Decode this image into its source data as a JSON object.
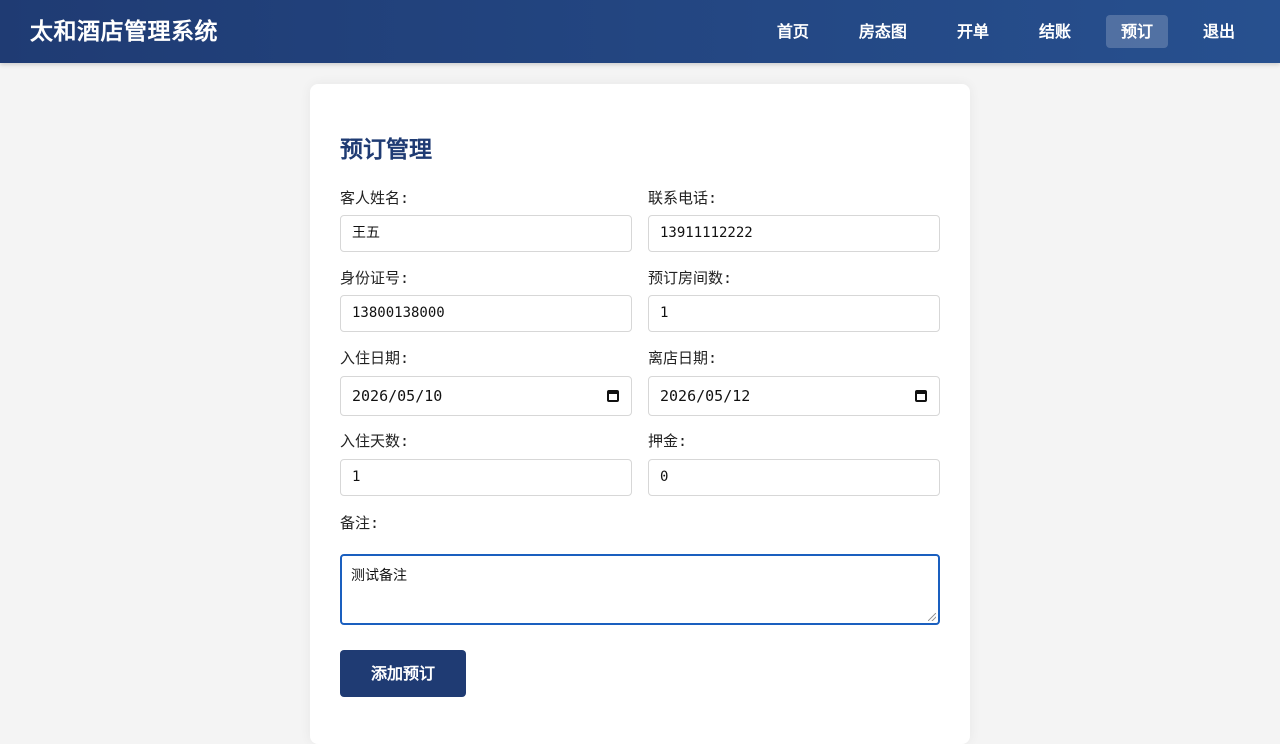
{
  "app": {
    "title": "太和酒店管理系统"
  },
  "nav": {
    "items": [
      {
        "label": "首页"
      },
      {
        "label": "房态图"
      },
      {
        "label": "开单"
      },
      {
        "label": "结账"
      },
      {
        "label": "预订"
      },
      {
        "label": "退出"
      }
    ],
    "active": "预订"
  },
  "form": {
    "title": "预订管理",
    "guest_name": {
      "label": "客人姓名:",
      "value": "王五"
    },
    "phone": {
      "label": "联系电话:",
      "value": "13911112222"
    },
    "id_number": {
      "label": "身份证号:",
      "value": "13800138000"
    },
    "room_count": {
      "label": "预订房间数:",
      "value": "1"
    },
    "checkin_date": {
      "label": "入住日期:",
      "value": "2026/05/10",
      "icon": "calendar-icon"
    },
    "checkout_date": {
      "label": "离店日期:",
      "value": "2026/05/12",
      "icon": "calendar-icon"
    },
    "stay_days": {
      "label": "入住天数:",
      "value": "1"
    },
    "deposit": {
      "label": "押金:",
      "value": "0"
    },
    "notes": {
      "label": "备注:",
      "value": "测试备注"
    },
    "submit_label": "添加预订"
  },
  "colors": {
    "header_start": "#1f3b73",
    "header_end": "#27508f",
    "accent": "#1f3b73",
    "focus": "#1a5fbf",
    "background": "#f4f4f4"
  }
}
